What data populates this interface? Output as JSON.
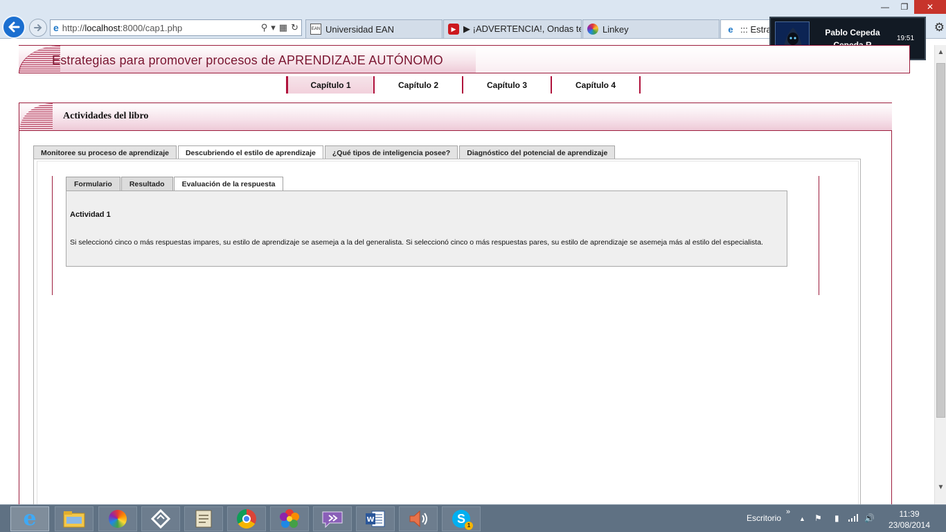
{
  "browser": {
    "address": {
      "prefix": "http://",
      "host": "localhost",
      "rest": ":8000/cap1.php"
    },
    "tabs": [
      {
        "label": "Universidad EAN"
      },
      {
        "label": "▶ ¡ADVERTENCIA!, Ondas teta ..."
      },
      {
        "label": "Linkey"
      },
      {
        "label": "::: Estrate"
      }
    ]
  },
  "notification": {
    "name_line1": "Pablo Cepeda",
    "name_line2": "Cepeda R",
    "time": "19:51"
  },
  "page": {
    "header_title": "Estrategias para promover procesos de  APRENDIZAJE AUTÓNOMO",
    "chapters": [
      "Capítulo 1",
      "Capítulo 2",
      "Capítulo 3",
      "Capítulo 4"
    ],
    "panel_title": "Actividades del libro",
    "outer_tabs": [
      "Monitoree su proceso de aprendizaje",
      "Descubriendo el estilo de aprendizaje",
      "¿Qué tipos de inteligencia posee?",
      "Diagnóstico del potencial de aprendizaje"
    ],
    "inner_tabs": [
      "Formulario",
      "Resultado",
      "Evaluación de la respuesta"
    ],
    "activity_title": "Actividad 1",
    "activity_text": "Si seleccionó cinco o más respuestas impares, su estilo de aprendizaje se asemeja a la del generalista. Si seleccionó cinco o más respuestas pares, su estilo de aprendizaje se asemeja más al estilo del especialista."
  },
  "taskbar": {
    "desktop_label": "Escritorio",
    "time": "11:39",
    "date": "23/08/2014",
    "skype_badge": "1"
  },
  "colors": {
    "accent": "#9c1c3c",
    "chrome": "#dbe6f2",
    "taskbar": "#5f7183"
  }
}
